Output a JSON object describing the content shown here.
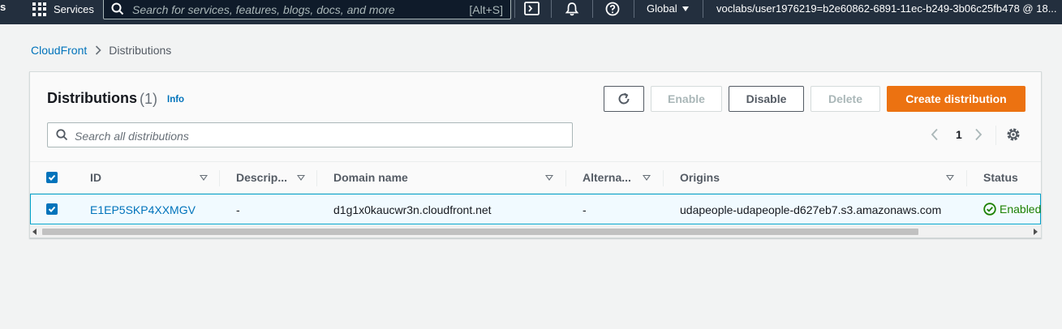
{
  "topnav": {
    "logo_fragment": "s",
    "services_label": "Services",
    "search_placeholder": "Search for services, features, blogs, docs, and more",
    "search_shortcut": "[Alt+S]",
    "region_label": "Global",
    "account_label": "voclabs/user1976219=b2e60862-6891-11ec-b249-3b06c25fb478 @ 18..."
  },
  "breadcrumb": {
    "service": "CloudFront",
    "current": "Distributions"
  },
  "header": {
    "title": "Distributions",
    "count": "(1)",
    "info_label": "Info"
  },
  "buttons": {
    "enable": "Enable",
    "disable": "Disable",
    "delete": "Delete",
    "create": "Create distribution"
  },
  "search": {
    "placeholder": "Search all distributions"
  },
  "pagination": {
    "current_page": "1"
  },
  "table": {
    "columns": [
      "ID",
      "Descrip...",
      "Domain name",
      "Alterna...",
      "Origins",
      "Status"
    ],
    "rows": [
      {
        "selected": true,
        "id": "E1EP5SKP4XXMGV",
        "description": "-",
        "domain_name": "d1g1x0kaucwr3n.cloudfront.net",
        "alternate_domain": "-",
        "origins": "udapeople-udapeople-d627eb7.s3.amazonaws.com",
        "status": "Enabled"
      }
    ]
  },
  "colors": {
    "nav_bg": "#232f3e",
    "link": "#0073bb",
    "primary": "#ec7211",
    "success": "#1d8102",
    "selected_row_bg": "#f1faff",
    "selected_row_border": "#00a1c9"
  }
}
